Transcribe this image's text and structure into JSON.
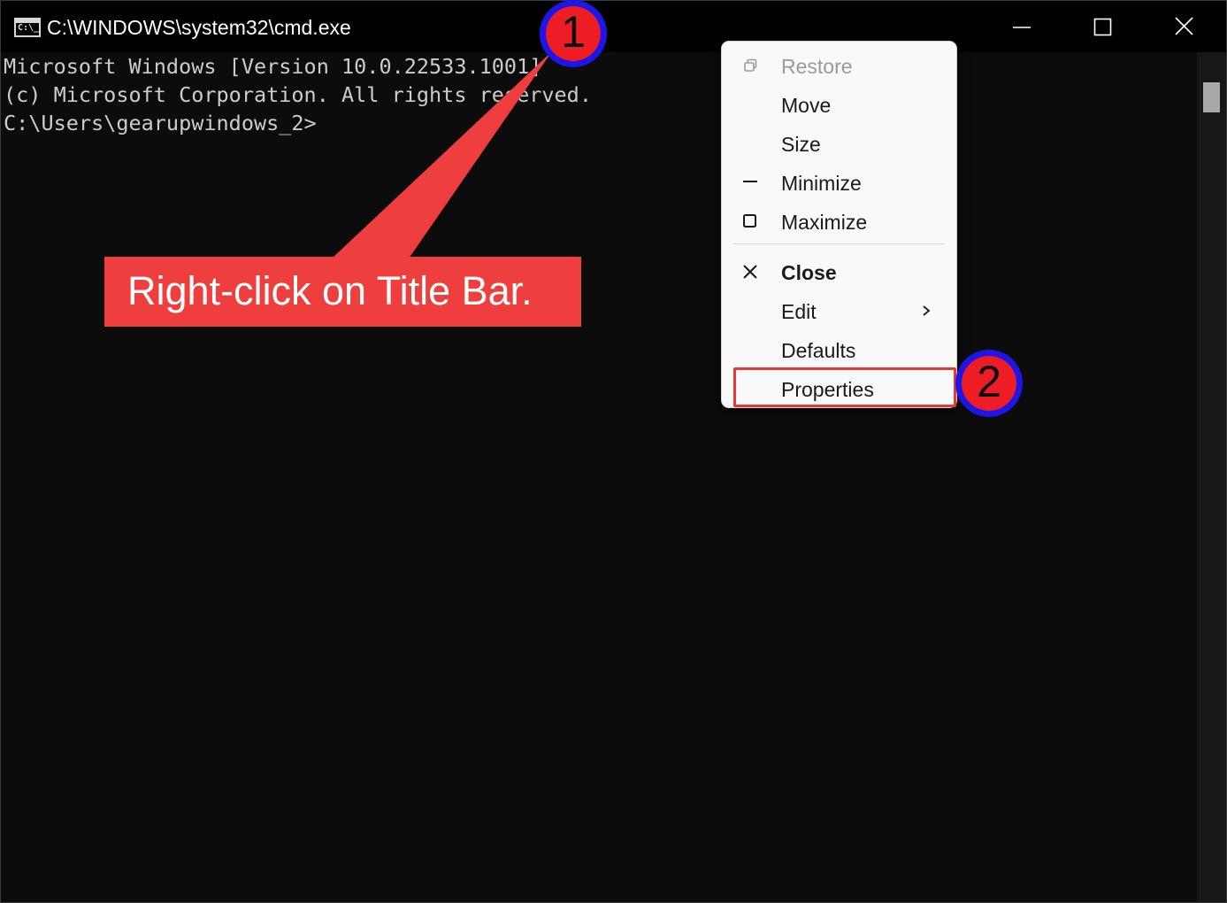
{
  "window": {
    "title": "C:\\WINDOWS\\system32\\cmd.exe",
    "icon_text": "C:\\_",
    "controls": [
      "minimize-icon",
      "maximize-icon",
      "close-icon"
    ]
  },
  "console": {
    "lines": [
      "Microsoft Windows [Version 10.0.22533.1001]",
      "(c) Microsoft Corporation. All rights reserved.",
      "",
      "C:\\Users\\gearupwindows_2>"
    ]
  },
  "context_menu": {
    "items": [
      {
        "label": "Restore",
        "icon": "restore-icon",
        "disabled": true
      },
      {
        "label": "Move",
        "icon": ""
      },
      {
        "label": "Size",
        "icon": ""
      },
      {
        "label": "Minimize",
        "icon": "minimize-icon"
      },
      {
        "label": "Maximize",
        "icon": "maximize-icon"
      },
      {
        "label": "Close",
        "icon": "close-icon",
        "bold": true
      },
      {
        "label": "Edit",
        "icon": "",
        "submenu": true
      },
      {
        "label": "Defaults",
        "icon": ""
      },
      {
        "label": "Properties",
        "icon": "",
        "highlighted": true
      }
    ]
  },
  "annotations": {
    "callout_text": "Right-click on Title Bar.",
    "badge_1": "1",
    "badge_2": "2",
    "callout_color": "#ef3e3e",
    "badge_ring_color": "#1d16e6",
    "badge_fill_color": "#ee1c24"
  }
}
